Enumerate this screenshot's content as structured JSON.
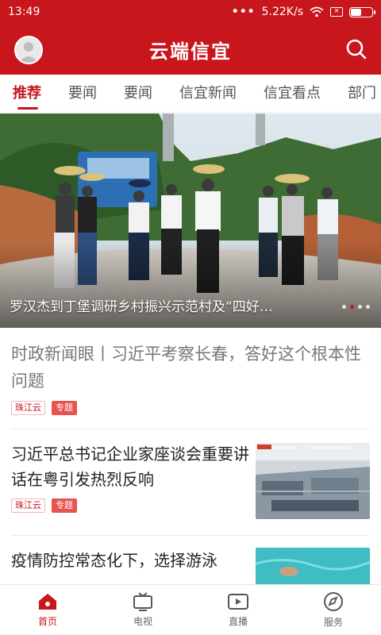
{
  "status": {
    "time": "13:49",
    "dots": "•••",
    "speed": "5.22K/s",
    "sim": "×",
    "battery": 0.45
  },
  "header": {
    "title": "云端信宜"
  },
  "tabs": [
    {
      "label": "推荐"
    },
    {
      "label": "要闻"
    },
    {
      "label": "要闻"
    },
    {
      "label": "信宜新闻"
    },
    {
      "label": "信宜看点"
    },
    {
      "label": "部门"
    }
  ],
  "hero": {
    "caption": "罗汉杰到丁堡调研乡村振兴示范村及“四好…"
  },
  "articles": [
    {
      "title": "时政新闻眼丨习近平考察长春，答好这个根本性问题",
      "source": "珠江云",
      "tag": "专题"
    },
    {
      "title": "习近平总书记企业家座谈会重要讲话在粤引发热烈反响",
      "source": "珠江云",
      "tag": "专题"
    },
    {
      "title": "疫情防控常态化下，选择游泳"
    }
  ],
  "bottom_nav": [
    {
      "label": "首页"
    },
    {
      "label": "电视"
    },
    {
      "label": "直播"
    },
    {
      "label": "服务"
    }
  ],
  "colors": {
    "brand": "#c8161d",
    "tag_bg": "#e8524f"
  },
  "icons": {
    "header_left": "avatar-icon",
    "header_right": "search-icon",
    "nav": [
      "home-icon",
      "tv-icon",
      "live-icon",
      "compass-icon"
    ]
  }
}
